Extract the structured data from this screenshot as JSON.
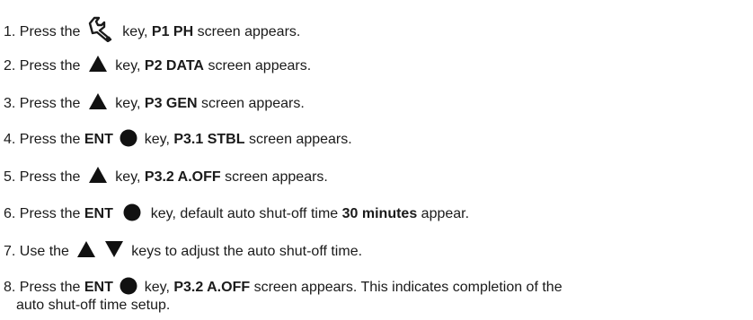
{
  "steps": [
    {
      "num": "1.",
      "pre": "Press the",
      "post": "key,",
      "screen": "P1 PH",
      "tail": "screen appears.",
      "icon": "wrench-icon"
    },
    {
      "num": "2.",
      "pre": "Press the",
      "post": "key,",
      "screen": "P2 DATA",
      "tail": "screen appears.",
      "icon": "up-triangle-icon"
    },
    {
      "num": "3.",
      "pre": "Press the",
      "post": "key,",
      "screen": "P3 GEN",
      "tail": "screen appears.",
      "icon": "up-triangle-icon"
    },
    {
      "num": "4.",
      "pre": "Press the",
      "key": "ENT",
      "post": "key,",
      "screen": "P3.1 STBL",
      "tail": "screen appears.",
      "icon": "circle-icon"
    },
    {
      "num": "5.",
      "pre": "Press the",
      "post": "key,",
      "screen": "P3.2 A.OFF",
      "tail": "screen appears.",
      "icon": "up-triangle-icon"
    },
    {
      "num": "6.",
      "pre": "Press the",
      "key": "ENT",
      "post": "key, default auto shut-off time",
      "screen": "30 minutes",
      "tail": "appear.",
      "icon": "circle-icon"
    },
    {
      "num": "7.",
      "pre": "Use the",
      "post": "keys to adjust the auto shut-off time.",
      "icons": [
        "up-triangle-icon",
        "down-triangle-icon"
      ]
    },
    {
      "num": "8.",
      "pre": "Press the",
      "key": "ENT",
      "post": "key,",
      "screen": "P3.2 A.OFF",
      "tail": "screen appears. This indicates completion of the",
      "tail2": "auto shut-off time setup.",
      "icon": "circle-icon"
    }
  ]
}
